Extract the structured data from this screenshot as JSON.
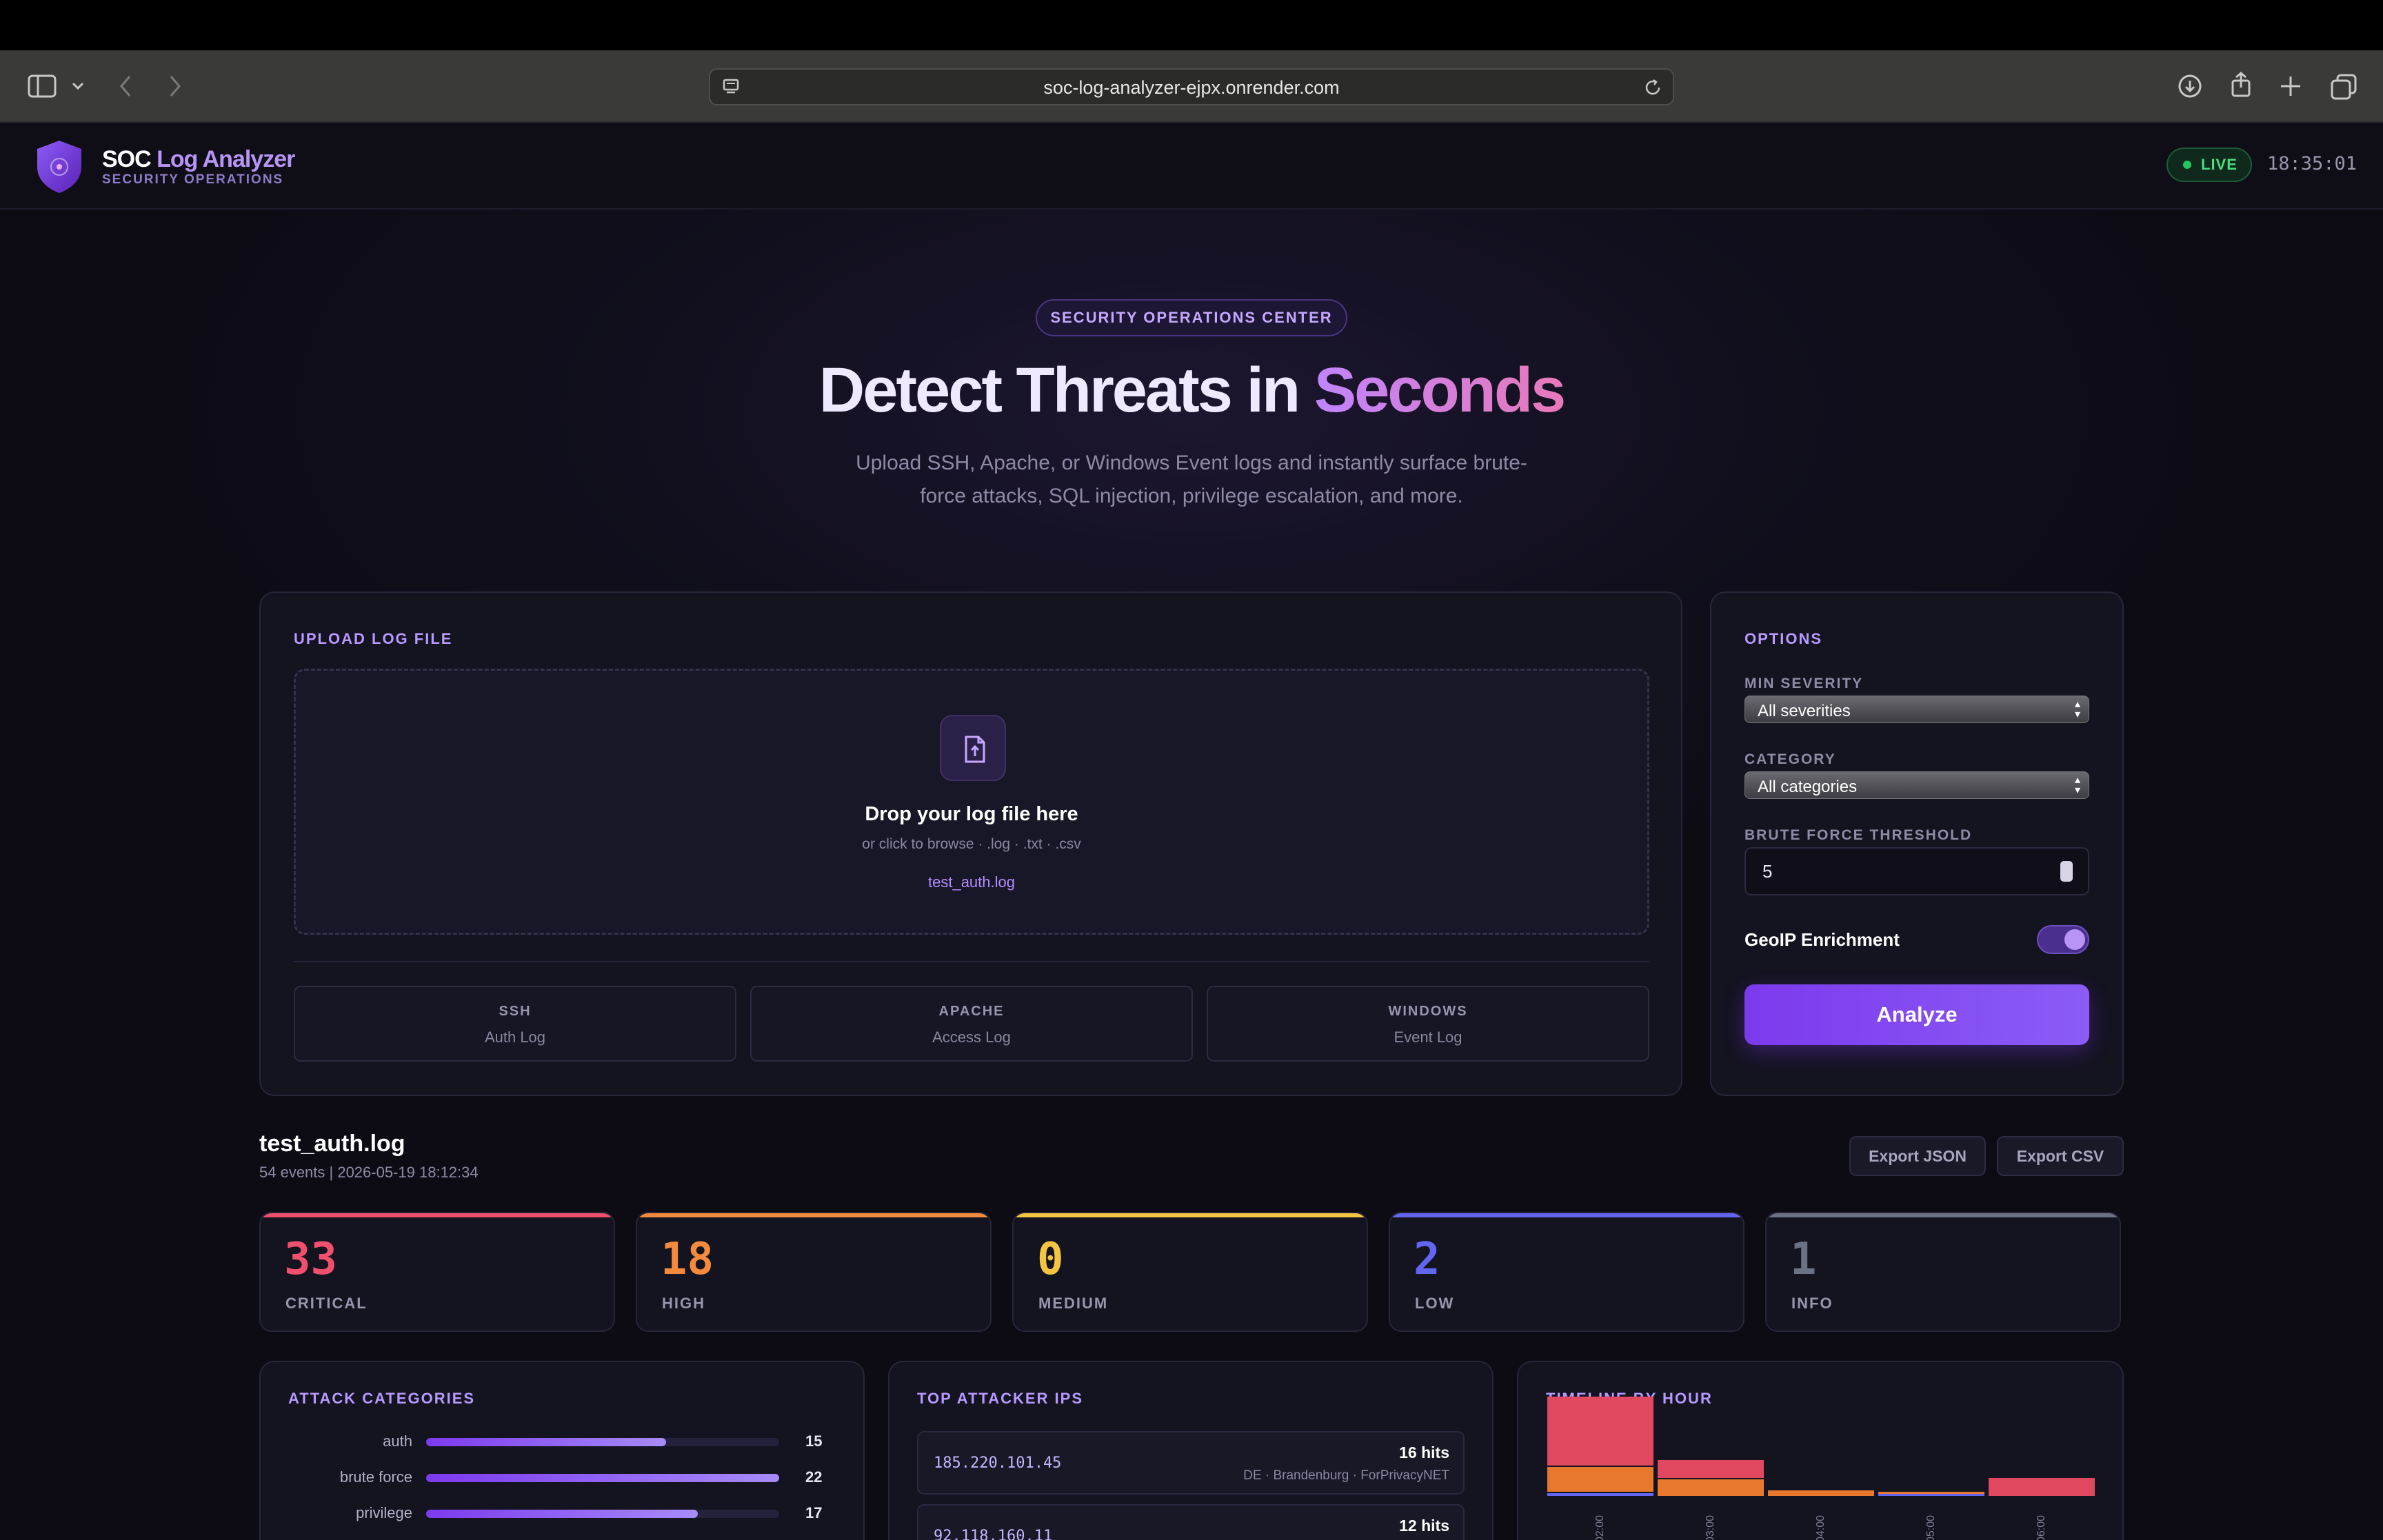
{
  "browser": {
    "url": "soc-log-analyzer-ejpx.onrender.com"
  },
  "header": {
    "brand_main": "SOC",
    "brand_accent": "Log Analyzer",
    "brand_sub": "SECURITY OPERATIONS",
    "live_label": "LIVE",
    "clock": "18:35:01"
  },
  "hero": {
    "badge": "SECURITY OPERATIONS CENTER",
    "title_main": "Detect Threats in ",
    "title_accent": "Seconds",
    "subtitle_line1": "Upload SSH, Apache, or Windows Event logs and instantly surface brute-",
    "subtitle_line2": "force attacks, SQL injection, privilege escalation, and more."
  },
  "upload": {
    "label": "UPLOAD LOG FILE",
    "drop_title": "Drop your log file here",
    "drop_sub": "or click to browse · .log · .txt · .csv",
    "selected_file": "test_auth.log",
    "log_types": [
      {
        "name": "SSH",
        "desc": "Auth Log"
      },
      {
        "name": "APACHE",
        "desc": "Access Log"
      },
      {
        "name": "WINDOWS",
        "desc": "Event Log"
      }
    ]
  },
  "options": {
    "label": "OPTIONS",
    "min_severity_label": "MIN SEVERITY",
    "min_severity_value": "All severities",
    "category_label": "CATEGORY",
    "category_value": "All categories",
    "threshold_label": "BRUTE FORCE THRESHOLD",
    "threshold_value": "5",
    "geoip_label": "GeoIP Enrichment",
    "geoip_enabled": true,
    "analyze_label": "Analyze"
  },
  "results": {
    "file_name": "test_auth.log",
    "summary": "54 events | 2026-05-19 18:12:34",
    "export_json": "Export JSON",
    "export_csv": "Export CSV",
    "stats": [
      {
        "count": "33",
        "label": "CRITICAL",
        "color": "#f0506e"
      },
      {
        "count": "18",
        "label": "HIGH",
        "color": "#f58a3c"
      },
      {
        "count": "0",
        "label": "MEDIUM",
        "color": "#f5c542"
      },
      {
        "count": "2",
        "label": "LOW",
        "color": "#6366f1"
      },
      {
        "count": "1",
        "label": "INFO",
        "color": "#6b7285"
      }
    ]
  },
  "attack_categories": {
    "label": "ATTACK CATEGORIES",
    "items": [
      {
        "name": "auth",
        "value": "15",
        "fraction": 0.68
      },
      {
        "name": "brute force",
        "value": "22",
        "fraction": 1.0
      },
      {
        "name": "privilege",
        "value": "17",
        "fraction": 0.77
      }
    ]
  },
  "top_attackers": {
    "label": "TOP ATTACKER IPS",
    "items": [
      {
        "ip": "185.220.101.45",
        "hits": "16 hits",
        "geo": "DE · Brandenburg · ForPrivacyNET"
      },
      {
        "ip": "92.118.160.11",
        "hits": "12 hits",
        "geo": ""
      }
    ]
  },
  "timeline": {
    "label": "TIMELINE BY HOUR",
    "hours": [
      "02:00",
      "03:00",
      "04:00",
      "05:00",
      "06:00"
    ]
  },
  "colors": {
    "accent": "#8b5cf6",
    "critical": "#f0506e",
    "high": "#f58a3c",
    "medium": "#f5c542",
    "low": "#6366f1",
    "info": "#6b7285"
  }
}
